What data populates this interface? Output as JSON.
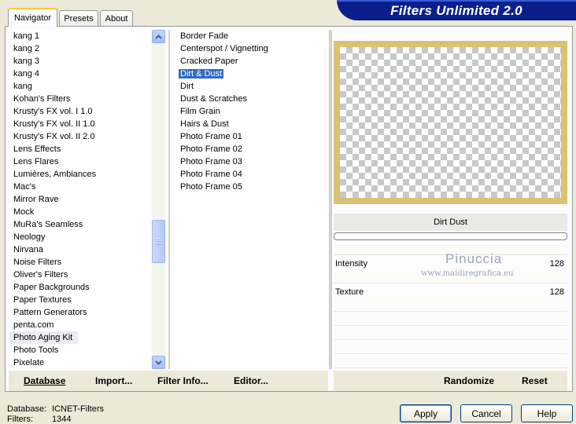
{
  "tabs": [
    "Navigator",
    "Presets",
    "About"
  ],
  "banner_title": "Filters Unlimited 2.0",
  "categories": [
    "kang 1",
    "kang 2",
    "kang 3",
    "kang 4",
    "kang",
    "Kohan's Filters",
    "Krusty's FX vol. I 1.0",
    "Krusty's FX vol. II 1.0",
    "Krusty's FX vol. II 2.0",
    "Lens Effects",
    "Lens Flares",
    "Lumières, Ambiances",
    "Mac's",
    "Mirror Rave",
    "Mock",
    "MuRa's Seamless",
    "Neology",
    "Nirvana",
    "Noise Filters",
    "Oliver's Filters",
    "Paper Backgrounds",
    "Paper Textures",
    "Pattern Generators",
    "penta.com",
    "Photo Aging Kit",
    "Photo Tools",
    "Pixelate"
  ],
  "selected_category": "Photo Aging Kit",
  "filters": [
    "Border Fade",
    "Centerspot / Vignetting",
    "Cracked Paper",
    "Dirt & Dust",
    "Dirt",
    "Dust & Scratches",
    "Film Grain",
    "Hairs & Dust",
    "Photo Frame 01",
    "Photo Frame 02",
    "Photo Frame 03",
    "Photo Frame 04",
    "Photo Frame 05"
  ],
  "selected_filter": "Dirt & Dust",
  "filter_title": "Dirt  Dust",
  "params": [
    {
      "label": "Intensity",
      "value": "128"
    },
    {
      "label": "Texture",
      "value": "128"
    }
  ],
  "watermark": {
    "name": "Pinuccia",
    "url": "www.maidiregrafica.eu"
  },
  "toolbar": {
    "database": "Database",
    "import": "Import...",
    "filter_info": "Filter Info...",
    "editor": "Editor...",
    "randomize": "Randomize",
    "reset": "Reset"
  },
  "footer": {
    "database_label": "Database:",
    "database_value": "ICNET-Filters",
    "filters_label": "Filters:",
    "filters_value": "1344"
  },
  "buttons": {
    "apply": "Apply",
    "cancel": "Cancel",
    "help": "Help"
  },
  "colors": {
    "banner": "#0b1f8c",
    "selection": "#316ac5",
    "frame": "#d9c273"
  }
}
